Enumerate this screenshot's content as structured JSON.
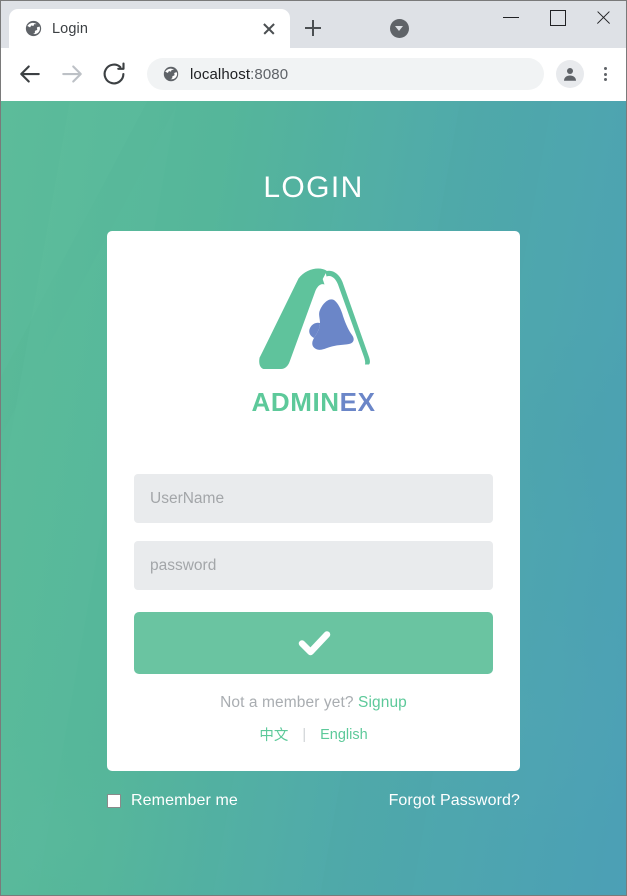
{
  "browser": {
    "tab": {
      "title": "Login",
      "favicon_icon": "globe-icon",
      "close_icon": "close-icon"
    },
    "new_tab_icon": "plus-icon",
    "tab_search_icon": "chevron-down-circle-icon",
    "window_controls": {
      "minimize_icon": "minimize-icon",
      "maximize_icon": "maximize-icon",
      "close_icon": "close-icon"
    },
    "toolbar": {
      "back_icon": "arrow-left-icon",
      "forward_icon": "arrow-right-icon",
      "reload_icon": "reload-icon",
      "site_icon": "globe-icon",
      "url_host": "localhost",
      "url_port": ":8080",
      "profile_icon": "person-icon",
      "menu_icon": "kebab-menu-icon"
    }
  },
  "page": {
    "heading": "LOGIN",
    "logo": {
      "icon": "adminex-logo-icon",
      "text_primary": "ADMIN",
      "text_secondary": "EX",
      "color_green": "#5dc99a",
      "color_blue": "#6b86c8"
    },
    "form": {
      "username": {
        "value": "",
        "placeholder": "UserName"
      },
      "password": {
        "value": "",
        "placeholder": "password"
      },
      "submit": {
        "icon": "check-icon",
        "label": "",
        "color": "#6ac4a1"
      }
    },
    "signup": {
      "prompt": "Not a member yet?",
      "link_label": "Signup"
    },
    "languages": {
      "chinese": "中文",
      "separator": "|",
      "english": "English"
    },
    "footer": {
      "remember_label": "Remember me",
      "remember_checked": false,
      "forgot_label": "Forgot Password?"
    },
    "background": {
      "gradient_start": "#5cbd9a",
      "gradient_end": "#4a9cba"
    }
  }
}
